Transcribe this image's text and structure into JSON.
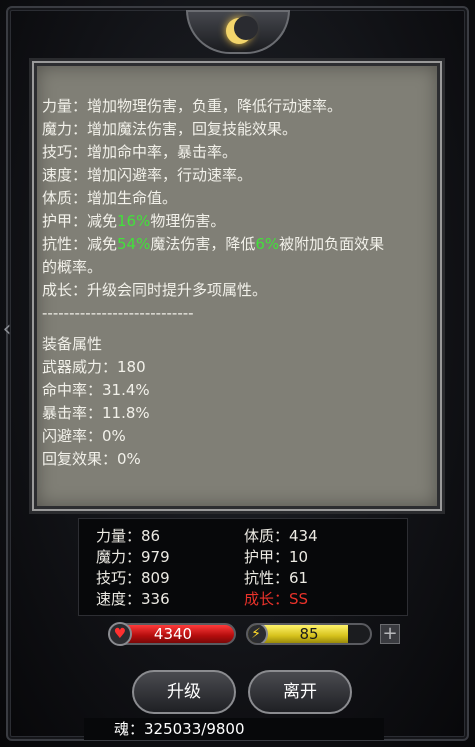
{
  "description": {
    "lines": [
      {
        "label": "力量：增加物理伤害，负重，降低行动速率。"
      },
      {
        "label": "魔力：增加魔法伤害，回复技能效果。"
      },
      {
        "label": "技巧：增加命中率，暴击率。"
      },
      {
        "label": "速度：增加闪避率，行动速率。"
      },
      {
        "label": "体质：增加生命值。"
      }
    ],
    "armor": {
      "pre": "护甲：减免",
      "pct": "16%",
      "post": "物理伤害。"
    },
    "resist": {
      "pre": "抗性：减免",
      "pct1": "54%",
      "mid": "魔法伤害，降低",
      "pct2": "6%",
      "post": "被附加负面效果的概率。"
    },
    "growth": "成长：升级会同时提升多项属性。",
    "divider": "----------------------------",
    "equip_title": "装备属性",
    "equip": [
      "武器威力：180",
      "命中率：31.4%",
      "暴击率：11.8%",
      "闪避率：0%",
      "回复效果：0%"
    ]
  },
  "stats": {
    "strength": "力量：86",
    "magic": "魔力：979",
    "skill": "技巧：809",
    "speed": "速度：336",
    "constitution": "体质：434",
    "armor": "护甲：10",
    "resist": "抗性：61",
    "growth": "成长：SS"
  },
  "hp": {
    "value": "4340",
    "icon": "heart-icon"
  },
  "energy": {
    "value": "85",
    "fill_fraction": 0.82,
    "icon": "lightning-icon"
  },
  "buttons": {
    "upgrade": "升级",
    "leave": "离开",
    "plus": "+"
  },
  "soul": "魂：325033/9800",
  "colors": {
    "highlight_green": "#43e03b",
    "growth_red": "#e8322a",
    "hp_red": "#c81414",
    "energy_yellow": "#e0cc20"
  }
}
